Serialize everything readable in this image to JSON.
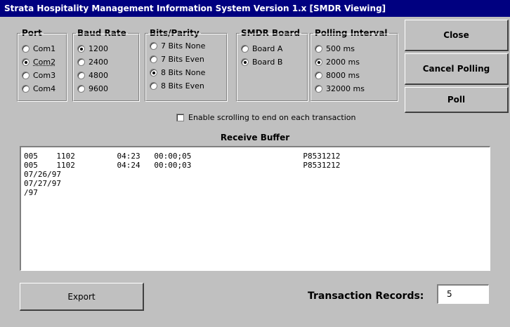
{
  "window": {
    "title": "Strata Hospitality Management Information System Version 1.x  [SMDR  Viewing]"
  },
  "groups": {
    "port": {
      "label": "Port",
      "options": [
        "Com1",
        "Com2",
        "Com3",
        "Com4"
      ],
      "selected": "Com2"
    },
    "baud": {
      "label": "Baud Rate",
      "options": [
        "1200",
        "2400",
        "4800",
        "9600"
      ],
      "selected": "1200"
    },
    "bits": {
      "label": "Bits/Parity",
      "options": [
        "7 Bits None",
        "7 Bits Even",
        "8 Bits None",
        "8 Bits Even"
      ],
      "selected": "8 Bits None"
    },
    "smdr": {
      "label": "SMDR Board",
      "options": [
        "Board A",
        "Board B"
      ],
      "selected": "Board B"
    },
    "poll": {
      "label": "Polling Interval",
      "options": [
        "500 ms",
        "2000 ms",
        "8000 ms",
        "32000 ms"
      ],
      "selected": "2000 ms"
    }
  },
  "buttons": {
    "close": "Close",
    "cancel_polling": "Cancel Polling",
    "poll": "Poll",
    "export": "Export"
  },
  "scroll_checkbox": {
    "label": "Enable scrolling to end on each transaction",
    "checked": false
  },
  "receive_buffer": {
    "title": "Receive Buffer",
    "lines": [
      "005    1102         04:23   00:00;05                        P8531212",
      "005    1102         04:24   00:00;03                        P8531212",
      "07/26/97",
      "07/27/97",
      "/97"
    ]
  },
  "transaction_records": {
    "label": "Transaction Records:",
    "value": "5"
  }
}
